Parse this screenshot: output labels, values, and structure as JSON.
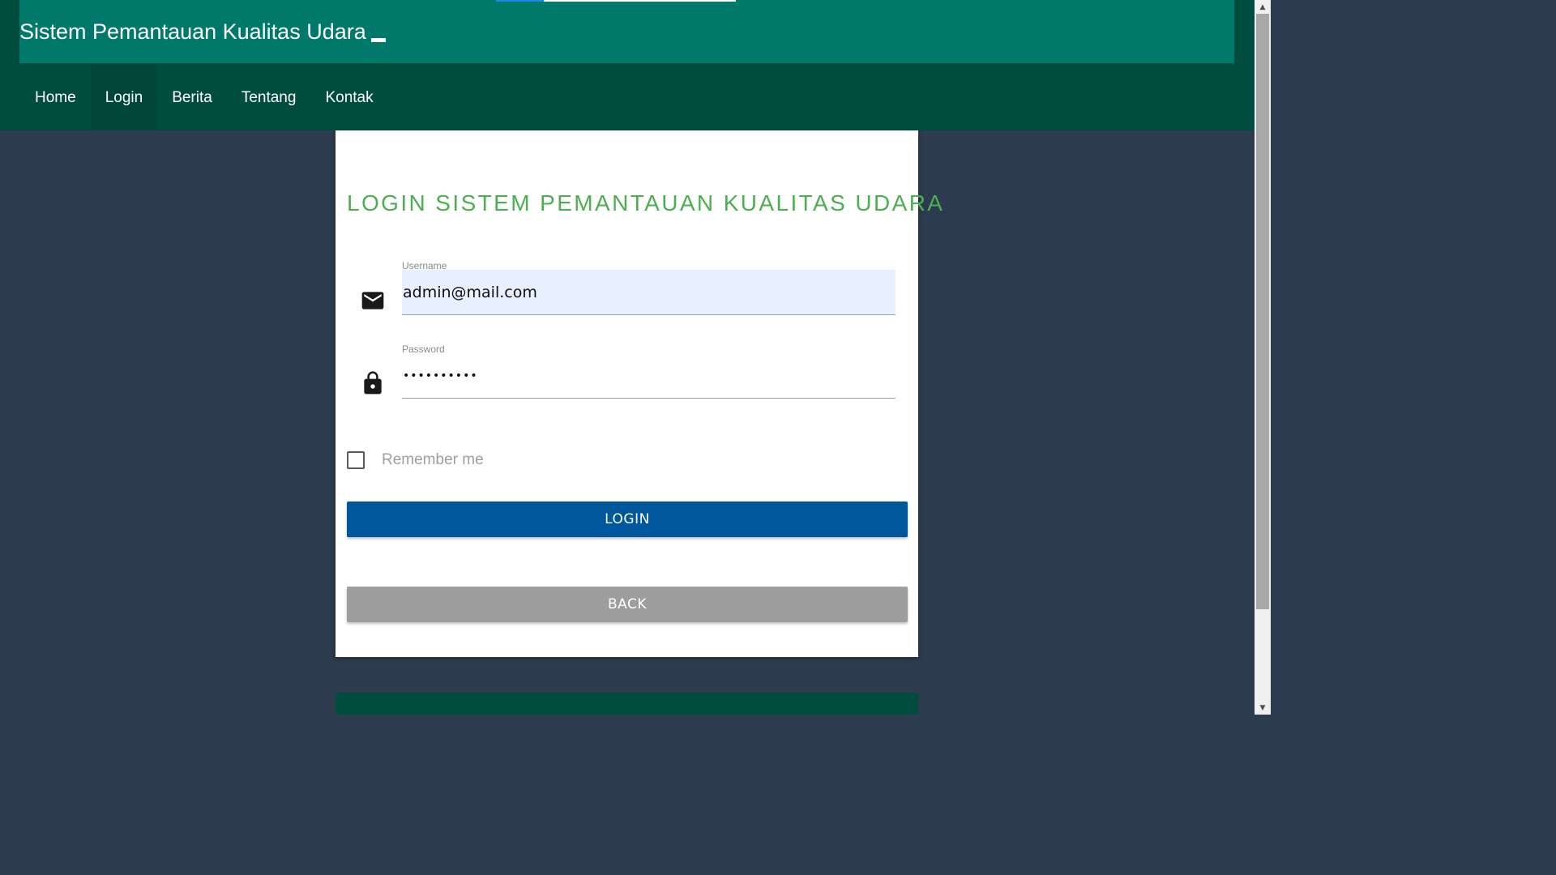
{
  "header": {
    "title": "Sistem Pemantauan Kualitas Udara"
  },
  "nav": {
    "items": [
      {
        "label": "Home",
        "active": false
      },
      {
        "label": "Login",
        "active": true
      },
      {
        "label": "Berita",
        "active": false
      },
      {
        "label": "Tentang",
        "active": false
      },
      {
        "label": "Kontak",
        "active": false
      }
    ]
  },
  "login": {
    "title": "LOGIN SISTEM PEMANTAUAN KUALITAS UDARA",
    "username_label": "Username",
    "username_value": "admin@mail.com",
    "password_label": "Password",
    "password_value": "••••••••••",
    "remember_label": "Remember me",
    "remember_checked": false,
    "login_button": "LOGIN",
    "back_button": "BACK"
  },
  "icons": {
    "username_icon": "envelope-icon",
    "password_icon": "lock-icon"
  },
  "colors": {
    "header_bg": "#00796b",
    "nav_bg": "#004d40",
    "page_bg": "#2d3b4f",
    "title_green": "#4caf50",
    "login_button": "#01579b",
    "back_button": "#9e9e9e",
    "autofill_bg": "#e8f0fe"
  }
}
